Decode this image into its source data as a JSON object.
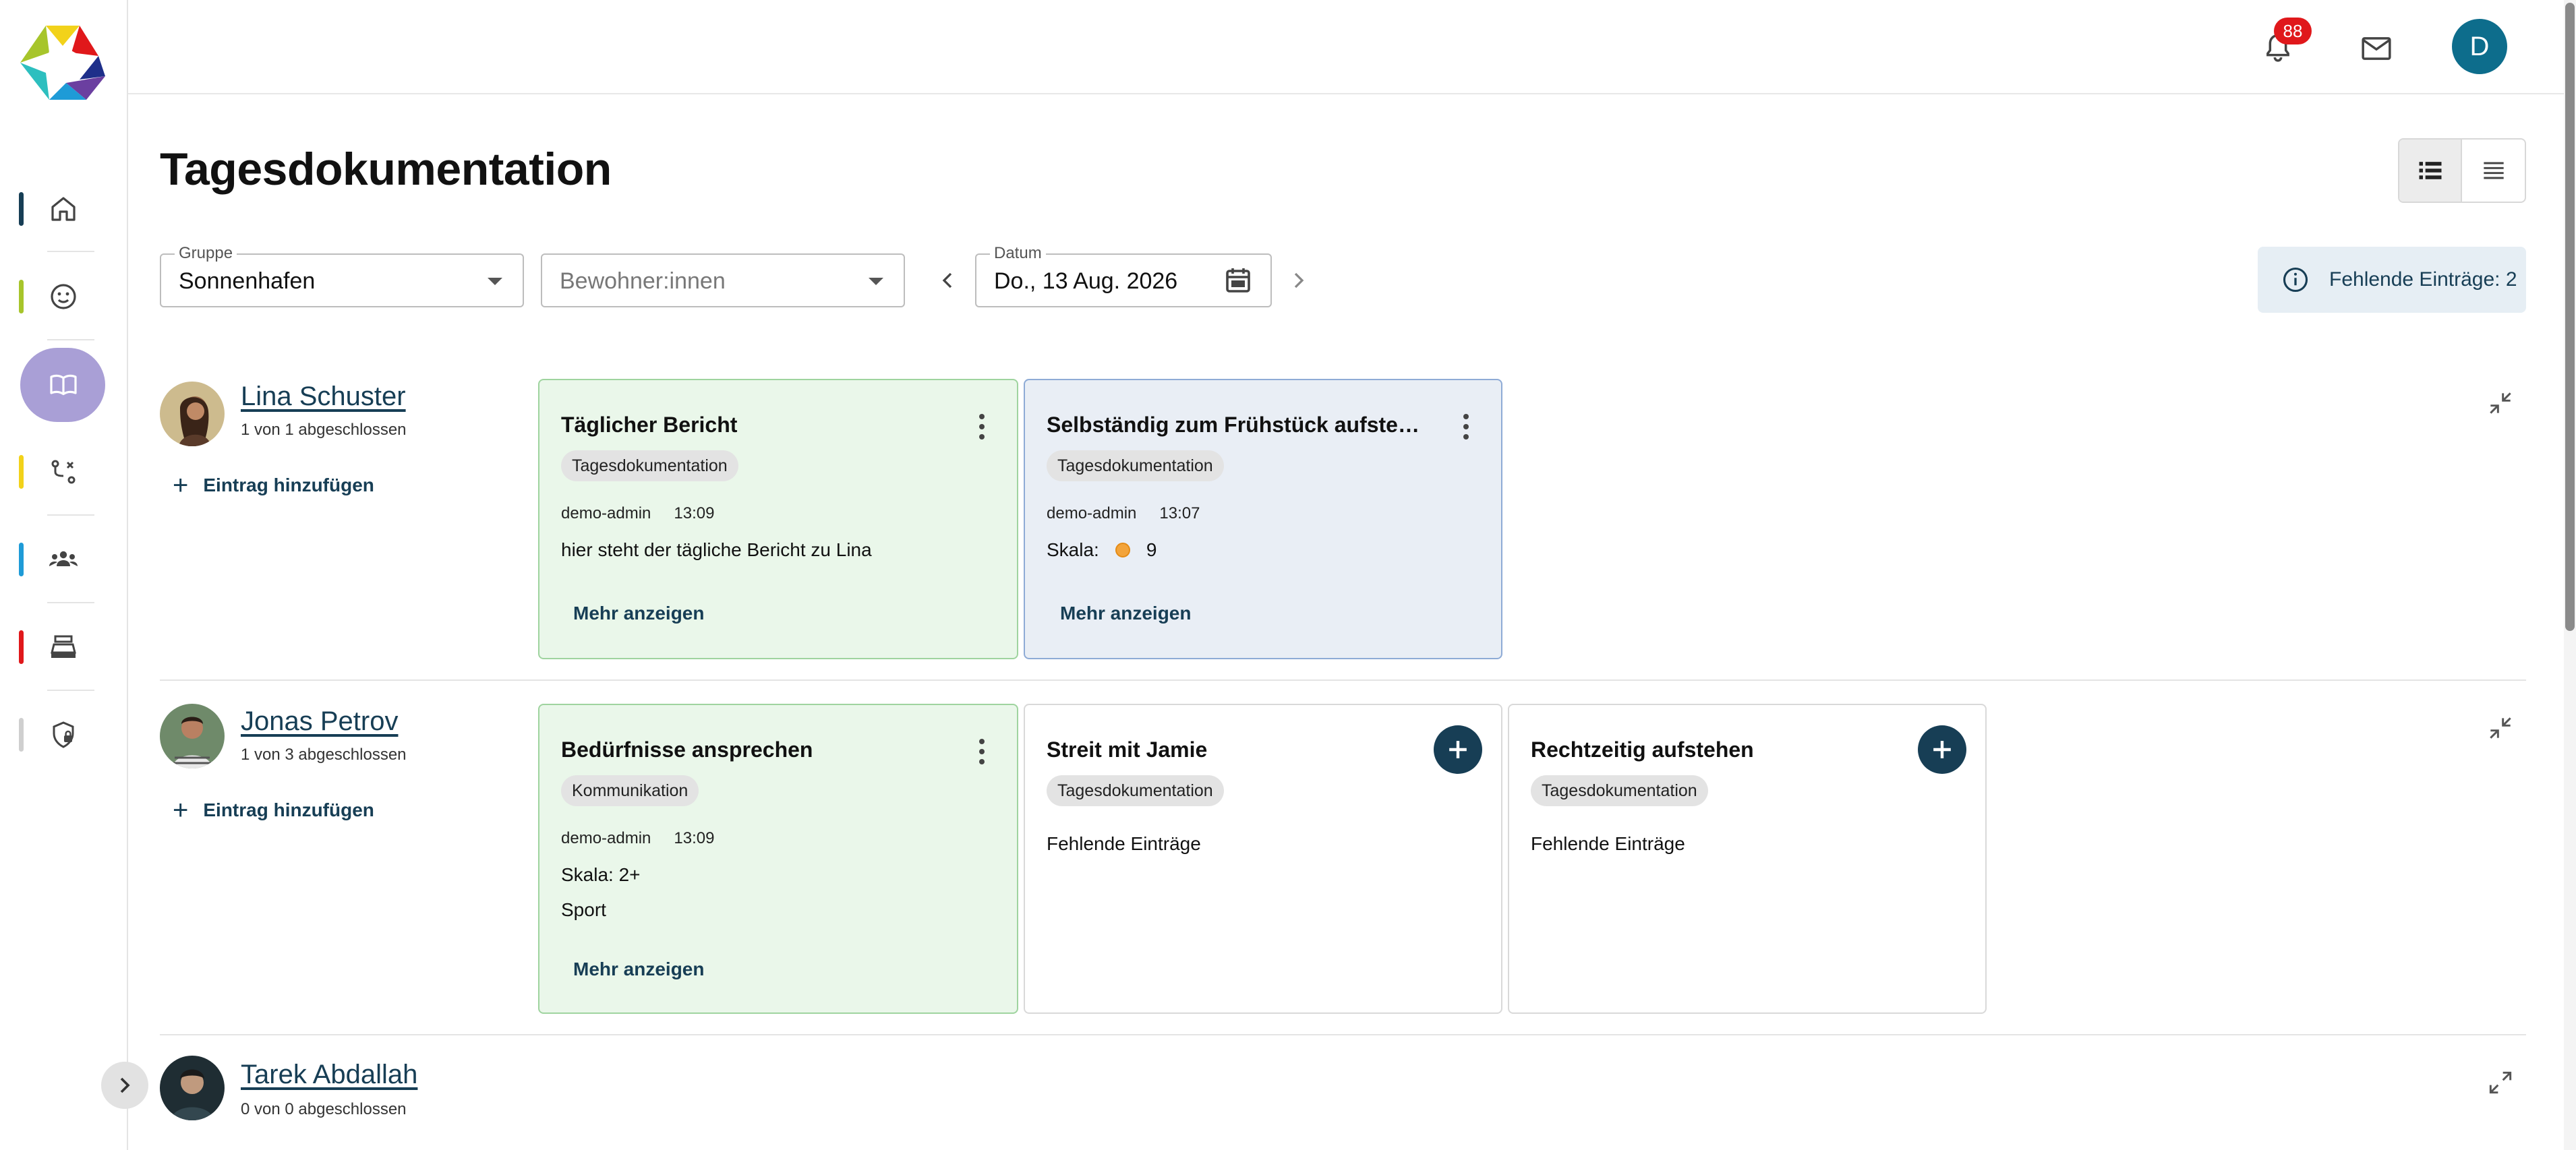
{
  "topbar": {
    "notifications_count": "88",
    "user_initial": "D"
  },
  "page": {
    "title": "Tagesdokumentation"
  },
  "filters": {
    "group_label": "Gruppe",
    "group_value": "Sonnenhafen",
    "residents_placeholder": "Bewohner:innen",
    "date_label": "Datum",
    "date_value": "Do., 13 Aug. 2026"
  },
  "missing": {
    "label": "Fehlende Einträge: 2"
  },
  "sidebar": {
    "items": [
      {
        "name": "home",
        "bar_color": "#173e55"
      },
      {
        "name": "emoji",
        "bar_color": "#a7c52b"
      },
      {
        "name": "book",
        "bar_color": "#a99fd6"
      },
      {
        "name": "routes",
        "bar_color": "#f2d21a"
      },
      {
        "name": "people",
        "bar_color": "#1e9bd7"
      },
      {
        "name": "cashbox",
        "bar_color": "#e0181b"
      },
      {
        "name": "shield",
        "bar_color": "#cfcfcf"
      }
    ]
  },
  "residents": [
    {
      "name": "Lina Schuster",
      "count": "1 von 1 abgeschlossen",
      "add_label": "Eintrag hinzufügen",
      "cards": [
        {
          "title": "Täglicher Bericht",
          "chip": "Tagesdokumentation",
          "author": "demo-admin",
          "time": "13:09",
          "text": "hier steht der tägliche Bericht zu Lina",
          "more": "Mehr anzeigen"
        },
        {
          "title": "Selbständig zum Frühstück aufsteh...",
          "chip": "Tagesdokumentation",
          "author": "demo-admin",
          "time": "13:07",
          "scale_label": "Skala:",
          "scale_value": "9",
          "more": "Mehr anzeigen"
        }
      ]
    },
    {
      "name": "Jonas Petrov",
      "count": "1 von 3 abgeschlossen",
      "add_label": "Eintrag hinzufügen",
      "cards": [
        {
          "title": "Bedürfnisse ansprechen",
          "chip": "Kommunikation",
          "author": "demo-admin",
          "time": "13:09",
          "scale_label": "Skala:",
          "scale_value": "2+",
          "text": "Sport",
          "more": "Mehr anzeigen"
        },
        {
          "title": "Streit mit Jamie",
          "chip": "Tagesdokumentation",
          "text": "Fehlende Einträge"
        },
        {
          "title": "Rechtzeitig aufstehen",
          "chip": "Tagesdokumentation",
          "text": "Fehlende Einträge"
        }
      ]
    },
    {
      "name": "Tarek Abdallah",
      "count": "0 von 0 abgeschlossen"
    }
  ]
}
